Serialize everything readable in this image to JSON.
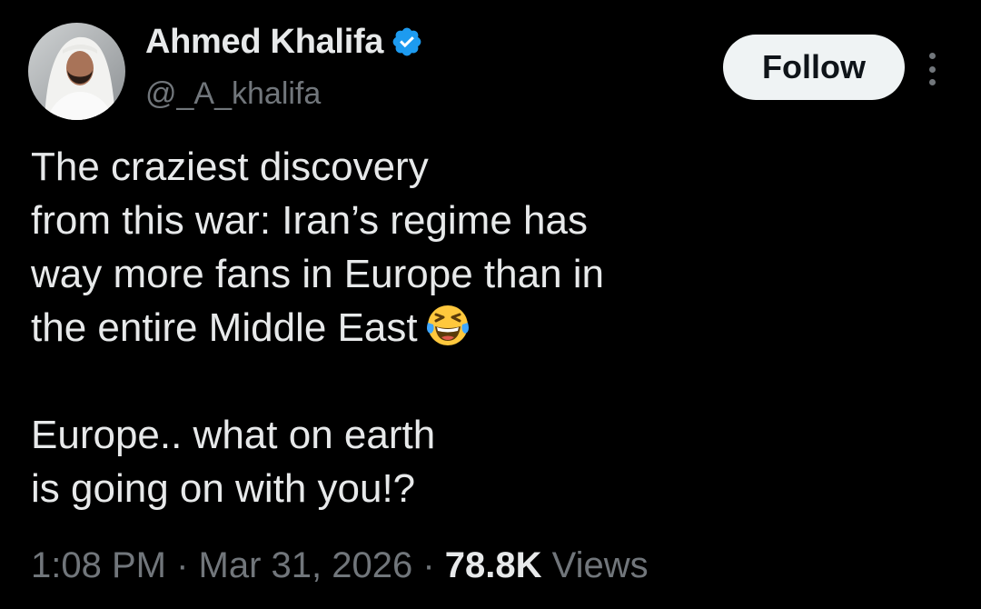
{
  "author": {
    "name": "Ahmed Khalifa",
    "handle": "@_A_khalifa",
    "verified_icon": "verified-badge-icon",
    "verified_color": "#1d9bf0"
  },
  "follow_button": {
    "label": "Follow"
  },
  "more_menu": {
    "icon": "more-vertical-icon"
  },
  "tweet": {
    "paragraph1_lines": [
      "The craziest discovery",
      "from this war: Iran’s regime has",
      "way more fans in Europe than in",
      "the entire Middle East"
    ],
    "paragraph1_emoji": "face-with-tears-of-joy",
    "paragraph2_lines": [
      "Europe.. what on earth",
      "is going on with you!?"
    ]
  },
  "meta": {
    "time": "1:08 PM",
    "separator": " · ",
    "date": "Mar 31, 2026",
    "views_count": "78.8K",
    "views_label": "Views"
  },
  "colors": {
    "background": "#000000",
    "text_primary": "#e7e9ea",
    "text_secondary": "#71767b",
    "follow_bg": "#eff3f4"
  }
}
